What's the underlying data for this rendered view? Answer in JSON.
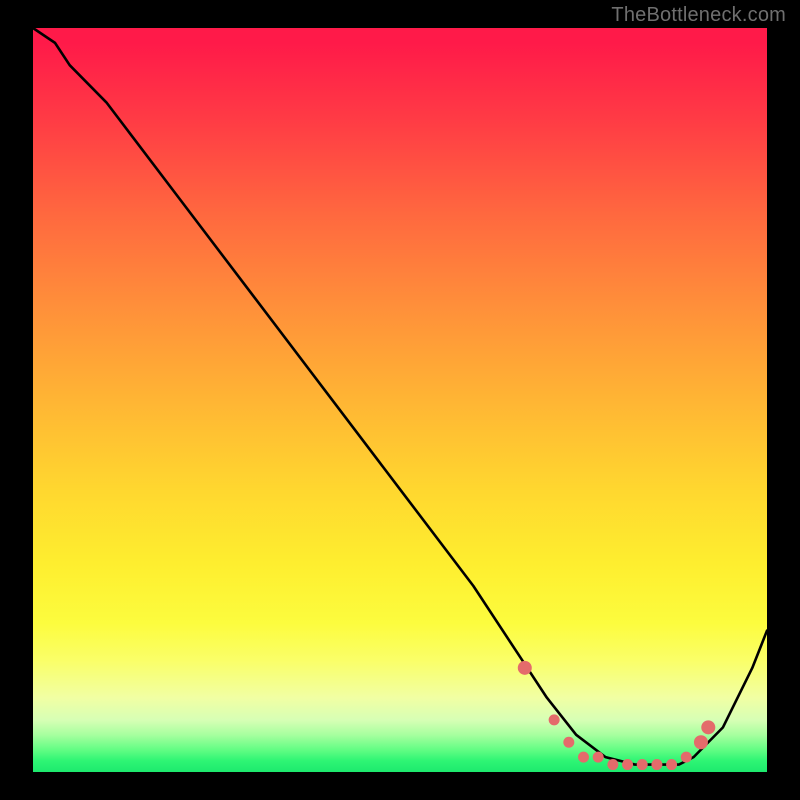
{
  "attribution": "TheBottleneck.com",
  "chart_data": {
    "type": "line",
    "title": "",
    "xlabel": "",
    "ylabel": "",
    "xlim": [
      0,
      100
    ],
    "ylim": [
      0,
      100
    ],
    "series": [
      {
        "name": "bottleneck-curve",
        "x": [
          0,
          3,
          5,
          10,
          20,
          30,
          40,
          50,
          60,
          66,
          70,
          74,
          78,
          82,
          86,
          88,
          90,
          94,
          98,
          100
        ],
        "values": [
          100,
          98,
          95,
          90,
          77,
          64,
          51,
          38,
          25,
          16,
          10,
          5,
          2,
          1,
          1,
          1,
          2,
          6,
          14,
          19
        ]
      }
    ],
    "dots": {
      "name": "highlight-dots",
      "x": [
        67,
        71,
        73,
        75,
        77,
        79,
        81,
        83,
        85,
        87,
        89,
        91,
        92
      ],
      "values": [
        14,
        7,
        4,
        2,
        2,
        1,
        1,
        1,
        1,
        1,
        2,
        4,
        6
      ]
    },
    "colors": {
      "curve": "#000000",
      "dots": "#e46b6b",
      "gradient_top": "#ff1a49",
      "gradient_bottom": "#1de96e"
    }
  }
}
